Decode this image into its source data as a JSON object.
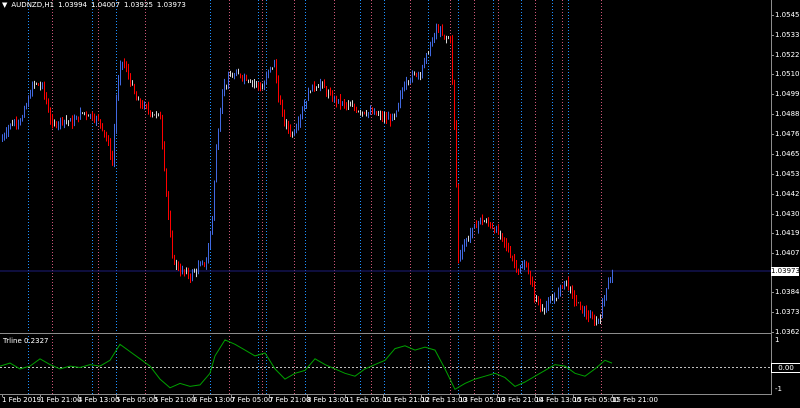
{
  "header": {
    "symbol": "AUDNZD,H1",
    "open": "1.03994",
    "high": "1.04007",
    "low": "1.03925",
    "close": "1.03973"
  },
  "indicator": {
    "name": "Trline 0.2327",
    "level_top": "1",
    "level_zero": "0.00",
    "level_bottom": "-1"
  },
  "price_scale": [
    "1.05450",
    "1.05335",
    "1.05220",
    "1.05105",
    "1.04995",
    "1.04880",
    "1.04765",
    "1.04650",
    "1.04535",
    "1.04420",
    "1.04305",
    "1.04190",
    "1.04075",
    "1.03973",
    "1.03845",
    "1.03730",
    "1.03620"
  ],
  "current_price": "1.03973",
  "time_scale": [
    "1 Feb 2019",
    "1 Feb 21:00",
    "4 Feb 13:00",
    "5 Feb 05:00",
    "5 Feb 21:00",
    "6 Feb 13:00",
    "7 Feb 05:00",
    "7 Feb 21:00",
    "8 Feb 13:00",
    "11 Feb 05:00",
    "11 Feb 21:00",
    "12 Feb 13:00",
    "13 Feb 05:00",
    "13 Feb 21:00",
    "14 Feb 13:00",
    "15 Feb 05:00",
    "15 Feb 21:00"
  ],
  "colors": {
    "background": "#000000",
    "bull": "#4169e1",
    "bear": "#ff0000",
    "neutral": "#d8d8d8",
    "indicator_line": "#00a000",
    "separator_blue": "#1e90ff",
    "separator_red": "#cc5577",
    "current_price_line": "#1c1c7a"
  },
  "chart_data": {
    "type": "line",
    "title": "AUDNZD,H1",
    "x": [
      "1 Feb 2019",
      "1 Feb 21:00",
      "4 Feb 13:00",
      "5 Feb 05:00",
      "5 Feb 21:00",
      "6 Feb 13:00",
      "7 Feb 05:00",
      "7 Feb 21:00",
      "8 Feb 13:00",
      "11 Feb 05:00",
      "11 Feb 21:00",
      "12 Feb 13:00",
      "13 Feb 05:00",
      "13 Feb 21:00",
      "14 Feb 13:00",
      "15 Feb 05:00",
      "15 Feb 21:00"
    ],
    "series": [
      {
        "values": [
          1.0475,
          1.0495,
          1.049,
          1.052,
          1.04,
          1.04,
          1.0515,
          1.051,
          1.0492,
          1.049,
          1.051,
          1.054,
          1.0425,
          1.0385,
          1.0378,
          1.037,
          1.0397
        ]
      }
    ],
    "price_path": [
      [
        0,
        1.0474
      ],
      [
        8,
        1.0483
      ],
      [
        22,
        1.0488
      ],
      [
        33,
        1.0508
      ],
      [
        42,
        1.0506
      ],
      [
        52,
        1.0483
      ],
      [
        62,
        1.0487
      ],
      [
        72,
        1.0485
      ],
      [
        82,
        1.0491
      ],
      [
        92,
        1.0489
      ],
      [
        100,
        1.0485
      ],
      [
        106,
        1.0476
      ],
      [
        112,
        1.0462
      ],
      [
        116,
        1.05
      ],
      [
        121,
        1.0522
      ],
      [
        128,
        1.0513
      ],
      [
        136,
        1.0498
      ],
      [
        148,
        1.0492
      ],
      [
        160,
        1.0488
      ],
      [
        168,
        1.043
      ],
      [
        172,
        1.0405
      ],
      [
        180,
        1.0398
      ],
      [
        190,
        1.0395
      ],
      [
        198,
        1.04
      ],
      [
        206,
        1.0403
      ],
      [
        212,
        1.043
      ],
      [
        216,
        1.047
      ],
      [
        222,
        1.0505
      ],
      [
        230,
        1.0512
      ],
      [
        240,
        1.0513
      ],
      [
        250,
        1.051
      ],
      [
        262,
        1.0505
      ],
      [
        268,
        1.0515
      ],
      [
        274,
        1.052
      ],
      [
        278,
        1.05
      ],
      [
        284,
        1.0485
      ],
      [
        292,
        1.0478
      ],
      [
        300,
        1.049
      ],
      [
        310,
        1.0505
      ],
      [
        320,
        1.0508
      ],
      [
        330,
        1.05
      ],
      [
        345,
        1.0495
      ],
      [
        360,
        1.0492
      ],
      [
        375,
        1.049
      ],
      [
        385,
        1.0487
      ],
      [
        395,
        1.0488
      ],
      [
        400,
        1.05
      ],
      [
        405,
        1.051
      ],
      [
        420,
        1.0515
      ],
      [
        430,
        1.053
      ],
      [
        437,
        1.0541
      ],
      [
        444,
        1.0534
      ],
      [
        450,
        1.0535
      ],
      [
        455,
        1.047
      ],
      [
        458,
        1.0405
      ],
      [
        462,
        1.0412
      ],
      [
        470,
        1.042
      ],
      [
        480,
        1.0428
      ],
      [
        490,
        1.0425
      ],
      [
        498,
        1.042
      ],
      [
        508,
        1.041
      ],
      [
        518,
        1.0398
      ],
      [
        526,
        1.0402
      ],
      [
        533,
        1.0385
      ],
      [
        540,
        1.0376
      ],
      [
        548,
        1.0378
      ],
      [
        558,
        1.0385
      ],
      [
        565,
        1.0393
      ],
      [
        572,
        1.0383
      ],
      [
        580,
        1.0376
      ],
      [
        590,
        1.037
      ],
      [
        596,
        1.0368
      ],
      [
        600,
        1.0372
      ],
      [
        606,
        1.0389
      ],
      [
        612,
        1.0397
      ]
    ],
    "indicator_path": [
      [
        0,
        0.05
      ],
      [
        10,
        0.15
      ],
      [
        20,
        -0.05
      ],
      [
        30,
        0.05
      ],
      [
        40,
        0.3
      ],
      [
        50,
        0.1
      ],
      [
        60,
        -0.05
      ],
      [
        70,
        0.05
      ],
      [
        80,
        0.0
      ],
      [
        90,
        0.1
      ],
      [
        100,
        0.05
      ],
      [
        110,
        0.25
      ],
      [
        120,
        0.8
      ],
      [
        130,
        0.55
      ],
      [
        140,
        0.3
      ],
      [
        150,
        0.05
      ],
      [
        160,
        -0.4
      ],
      [
        170,
        -0.7
      ],
      [
        180,
        -0.55
      ],
      [
        190,
        -0.65
      ],
      [
        200,
        -0.6
      ],
      [
        210,
        -0.2
      ],
      [
        215,
        0.4
      ],
      [
        225,
        0.95
      ],
      [
        235,
        0.8
      ],
      [
        245,
        0.6
      ],
      [
        255,
        0.4
      ],
      [
        265,
        0.5
      ],
      [
        275,
        -0.05
      ],
      [
        285,
        -0.4
      ],
      [
        295,
        -0.2
      ],
      [
        305,
        -0.1
      ],
      [
        315,
        0.3
      ],
      [
        325,
        0.1
      ],
      [
        335,
        -0.05
      ],
      [
        345,
        -0.2
      ],
      [
        355,
        -0.3
      ],
      [
        365,
        -0.05
      ],
      [
        375,
        0.1
      ],
      [
        385,
        0.25
      ],
      [
        395,
        0.65
      ],
      [
        405,
        0.75
      ],
      [
        415,
        0.6
      ],
      [
        425,
        0.7
      ],
      [
        435,
        0.6
      ],
      [
        445,
        -0.05
      ],
      [
        455,
        -0.75
      ],
      [
        465,
        -0.55
      ],
      [
        475,
        -0.4
      ],
      [
        485,
        -0.3
      ],
      [
        495,
        -0.2
      ],
      [
        505,
        -0.35
      ],
      [
        515,
        -0.65
      ],
      [
        525,
        -0.5
      ],
      [
        535,
        -0.3
      ],
      [
        545,
        -0.1
      ],
      [
        555,
        0.1
      ],
      [
        565,
        0.05
      ],
      [
        575,
        -0.2
      ],
      [
        585,
        -0.3
      ],
      [
        595,
        -0.05
      ],
      [
        605,
        0.25
      ],
      [
        612,
        0.15
      ]
    ],
    "ylim": [
      1.0362,
      1.055
    ],
    "indicator_ylim": [
      -1,
      1
    ],
    "grid": false
  }
}
